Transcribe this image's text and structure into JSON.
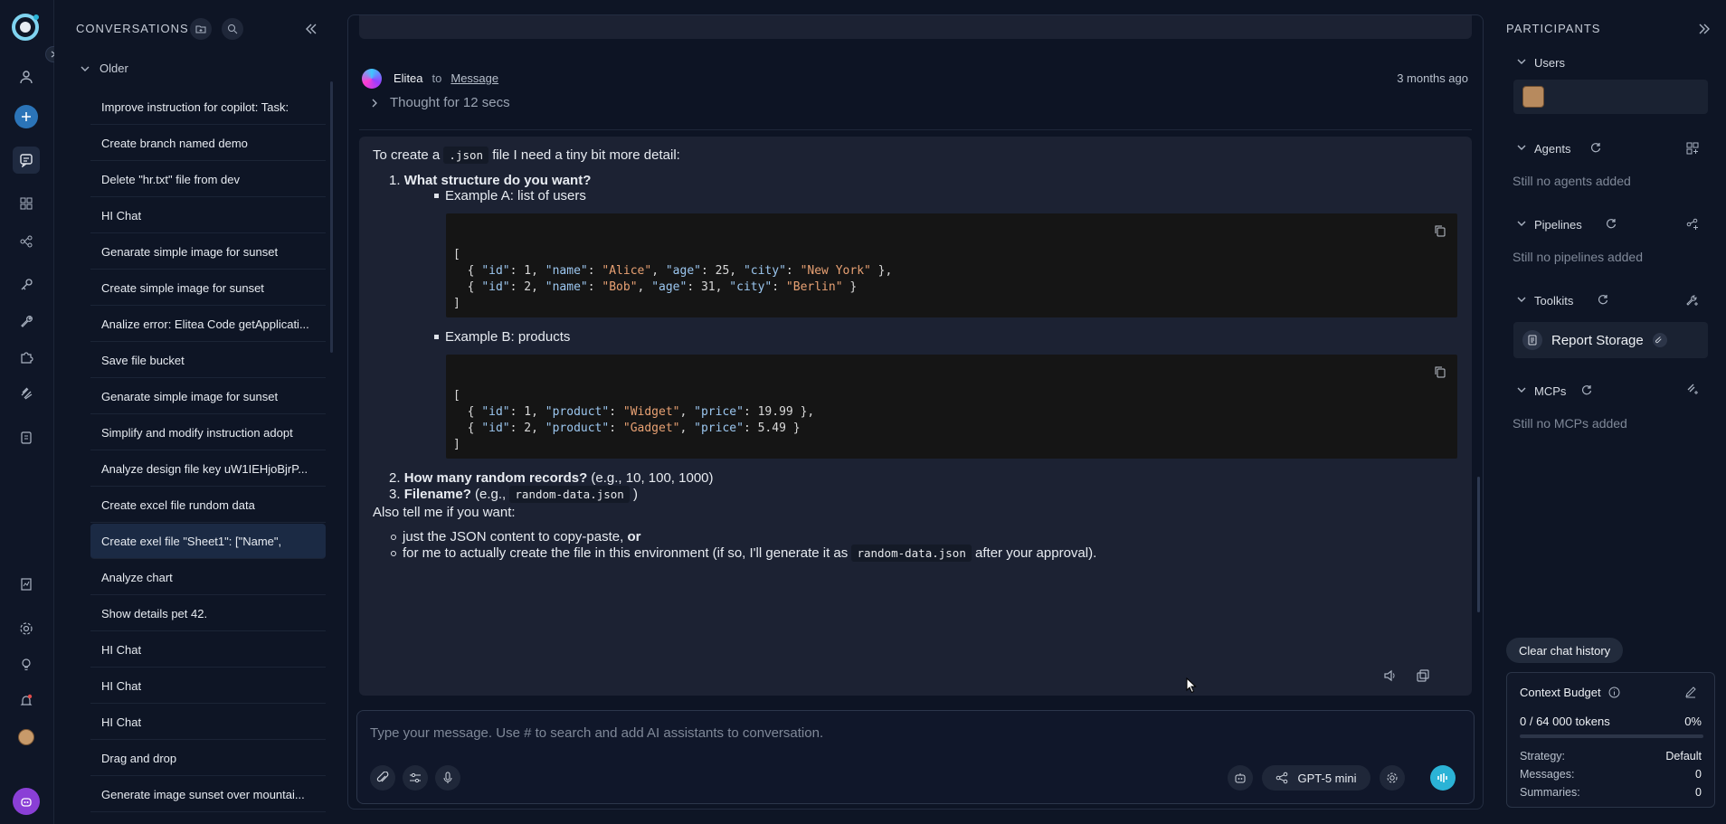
{
  "conversations": {
    "title": "CONVERSATIONS",
    "group_label": "Older",
    "items": [
      "Improve instruction for copilot: Task:",
      "Create branch named demo",
      "Delete \"hr.txt\" file from dev",
      "HI Chat",
      "Genarate simple image for sunset",
      "Create simple image for sunset",
      "Analize error: Elitea Code getApplicati...",
      "Save file bucket",
      "Genarate simple image for sunset",
      "Simplify and modify instruction adopt",
      "Analyze design file key uW1IEHjoBjrP...",
      "Create excel file rundom data",
      "Create exel file \"Sheet1\": [\"Name\",",
      "Analyze chart",
      "Show details pet 42.",
      "HI Chat",
      "HI Chat",
      "HI Chat",
      "Drag and drop",
      "Generate image sunset over mountai..."
    ],
    "active_index": 12
  },
  "message": {
    "author": "Elitea",
    "to_label": "to",
    "target": "Message",
    "time": "3 months ago",
    "thought": "Thought for 12 secs",
    "intro_before": "To create a",
    "intro_code": ".json",
    "intro_after": "file I need a tiny bit more detail:",
    "q1_num": "1.",
    "q1": "What structure do you want?",
    "exA": "Example A: list of users",
    "exB": "Example B: products",
    "q2_num": "2.",
    "q2": "How many random records?",
    "q2_hint": "(e.g., 10, 100, 1000)",
    "q3_num": "3.",
    "q3": "Filename?",
    "q3_hint_before": "(e.g.,",
    "q3_code": "random-data.json",
    "q3_hint_after": ")",
    "also": "Also tell me if you want:",
    "opt1": "just the JSON content to copy-paste,",
    "opt1_bold": "or",
    "opt2_before": "for me to actually create the file in this environment (if so, I'll generate it as",
    "opt2_code": "random-data.json",
    "opt2_after": "after your approval)."
  },
  "input": {
    "placeholder": "Type your message. Use # to search and add AI assistants to conversation.",
    "model": "GPT-5 mini"
  },
  "participants": {
    "title": "PARTICIPANTS",
    "users_label": "Users",
    "agents_label": "Agents",
    "agents_empty": "Still no agents added",
    "pipelines_label": "Pipelines",
    "pipelines_empty": "Still no pipelines added",
    "toolkits_label": "Toolkits",
    "toolkit_item": "Report Storage",
    "mcps_label": "MCPs",
    "mcps_empty": "Still no MCPs added",
    "clear_button": "Clear chat history"
  },
  "budget": {
    "title": "Context Budget",
    "tokens": "0 / 64 000 tokens",
    "percent": "0%",
    "fill_fraction": 0,
    "strategy_label": "Strategy:",
    "strategy_value": "Default",
    "messages_label": "Messages:",
    "messages_value": "0",
    "summaries_label": "Summaries:",
    "summaries_value": "0"
  },
  "colors": {
    "accent": "#2bb3d6",
    "active_item": "#1b2a44",
    "card": "#1c2233",
    "code_bg": "#151515"
  }
}
